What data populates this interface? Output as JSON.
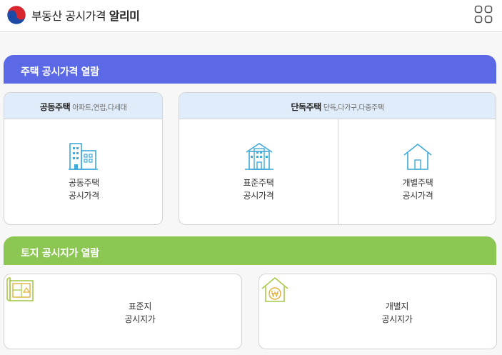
{
  "header": {
    "brand_main": "부동산 공시가격 ",
    "brand_bold": "알리미",
    "logo_icon": "taegeuk-emblem-icon",
    "menu_icon": "grid-menu-icon"
  },
  "house_section": {
    "title": "주택 공시가격 열람",
    "color": "#5b69e6",
    "apartment": {
      "heading": "공동주택",
      "subheading": "아파트,연립,다세대",
      "tile_label": "공동주택\n공시가격",
      "icon": "apartment-building-icon"
    },
    "detached": {
      "heading": "단독주택",
      "subheading": "단독,다가구,다중주택",
      "standard": {
        "label": "표준주택\n공시가격",
        "icon": "house-building-icon"
      },
      "individual": {
        "label": "개별주택\n공시가격",
        "icon": "house-icon"
      }
    }
  },
  "land_section": {
    "title": "토지 공시지가 열람",
    "color": "#8cc653",
    "standard": {
      "label": "표준지\n공시지가",
      "icon": "land-map-icon"
    },
    "individual": {
      "label": "개별지\n공시지가",
      "icon": "won-house-icon"
    }
  }
}
